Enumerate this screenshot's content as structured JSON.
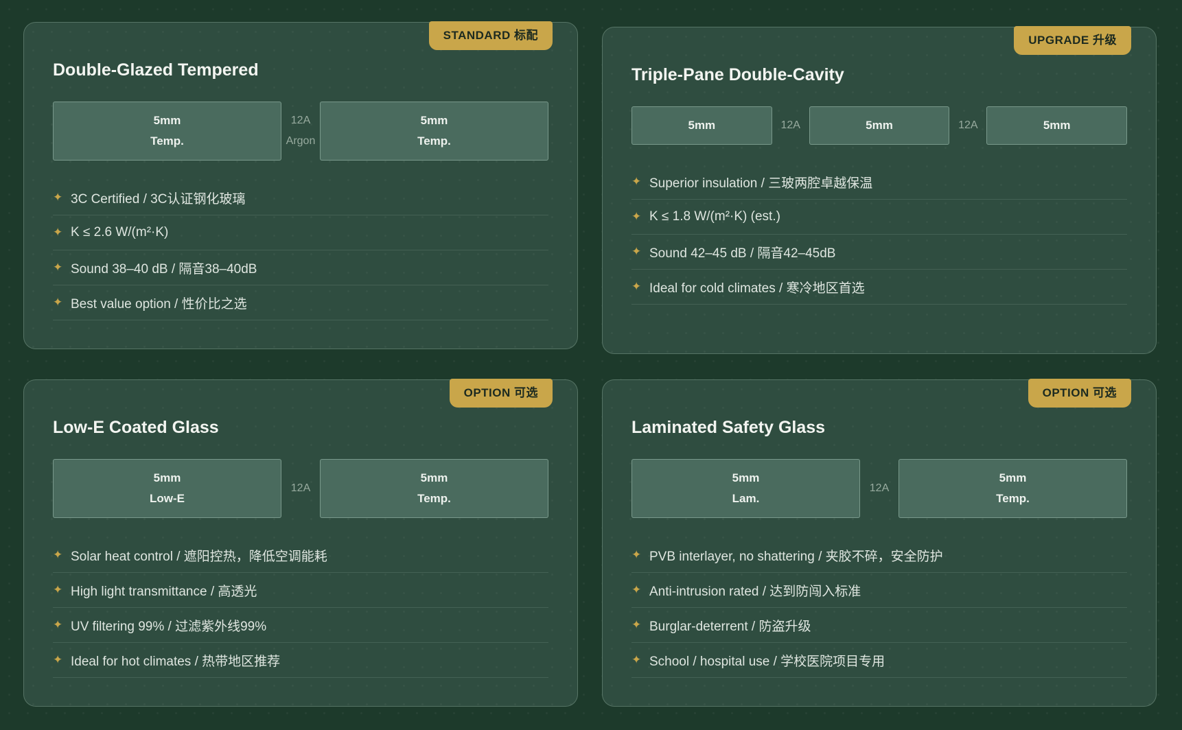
{
  "cards": [
    {
      "badge": "STANDARD 标配",
      "title": "Double-Glazed Tempered",
      "panes": [
        {
          "top": "5mm",
          "bottom": "Temp."
        },
        {
          "top": "5mm",
          "bottom": "Temp."
        }
      ],
      "gaps": [
        {
          "top": "12A",
          "bottom": "Argon"
        }
      ],
      "features": [
        "3C Certified / 3C认证钢化玻璃",
        "K ≤ 2.6 W/(m²·K)",
        "Sound 38–40 dB / 隔音38–40dB",
        "Best value option / 性价比之选"
      ]
    },
    {
      "badge": "UPGRADE 升级",
      "title": "Triple-Pane Double-Cavity",
      "panes": [
        {
          "top": "5mm"
        },
        {
          "top": "5mm"
        },
        {
          "top": "5mm"
        }
      ],
      "gaps": [
        {
          "top": "12A"
        },
        {
          "top": "12A"
        }
      ],
      "features": [
        "Superior insulation / 三玻两腔卓越保温",
        "K ≤ 1.8 W/(m²·K) (est.)",
        "Sound 42–45 dB / 隔音42–45dB",
        "Ideal for cold climates / 寒冷地区首选"
      ]
    },
    {
      "badge": "OPTION 可选",
      "title": "Low-E Coated Glass",
      "panes": [
        {
          "top": "5mm",
          "bottom": "Low-E"
        },
        {
          "top": "5mm",
          "bottom": "Temp."
        }
      ],
      "gaps": [
        {
          "top": "12A"
        }
      ],
      "features": [
        "Solar heat control / 遮阳控热，降低空调能耗",
        "High light transmittance / 高透光",
        "UV filtering 99% / 过滤紫外线99%",
        "Ideal for hot climates / 热带地区推荐"
      ]
    },
    {
      "badge": "OPTION 可选",
      "title": "Laminated Safety Glass",
      "panes": [
        {
          "top": "5mm",
          "bottom": "Lam."
        },
        {
          "top": "5mm",
          "bottom": "Temp."
        }
      ],
      "gaps": [
        {
          "top": "12A"
        }
      ],
      "features": [
        "PVB interlayer, no shattering / 夹胶不碎，安全防护",
        "Anti-intrusion rated / 达到防闯入标准",
        "Burglar-deterrent / 防盗升级",
        "School / hospital use / 学校医院项目专用"
      ]
    }
  ],
  "colors": {
    "background": "#1d3a2b",
    "card": "#2f4d40",
    "accent_gold": "#c9a64a",
    "pane": "#4a6b5e"
  },
  "icons": {
    "feature_bullet": "four-point-star-icon"
  }
}
